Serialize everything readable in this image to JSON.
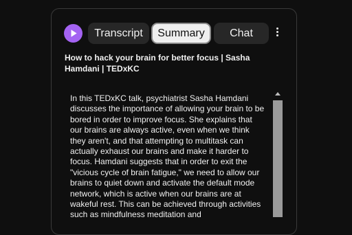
{
  "tabs": [
    {
      "label": "Transcript",
      "active": false
    },
    {
      "label": "Summary",
      "active": true
    },
    {
      "label": "Chat",
      "active": false
    }
  ],
  "video_title": "How to hack your brain for better focus | Sasha Hamdani | TEDxKC",
  "summary_text": "In this TEDxKC talk, psychiatrist Sasha Hamdani discusses the importance of allowing your brain to be bored in order to improve focus. She explains that our brains are always active, even when we think they aren't, and that attempting to multitask can actually exhaust our brains and make it harder to focus. Hamdani suggests that in order to exit the \"vicious cycle of brain fatigue,\" we need to allow our brains to quiet down and activate the default mode network, which is active when our brains are at wakeful rest. This can be achieved through activities such as mindfulness meditation and",
  "colors": {
    "logo": "#a463f2",
    "active_tab_bg": "#efefef",
    "tab_bg": "#272727",
    "page_bg": "#0f0f0f"
  },
  "icons": {
    "logo": "play-logo-icon",
    "menu": "more-vert-icon",
    "scroll": "scroll-up-arrow-icon"
  }
}
